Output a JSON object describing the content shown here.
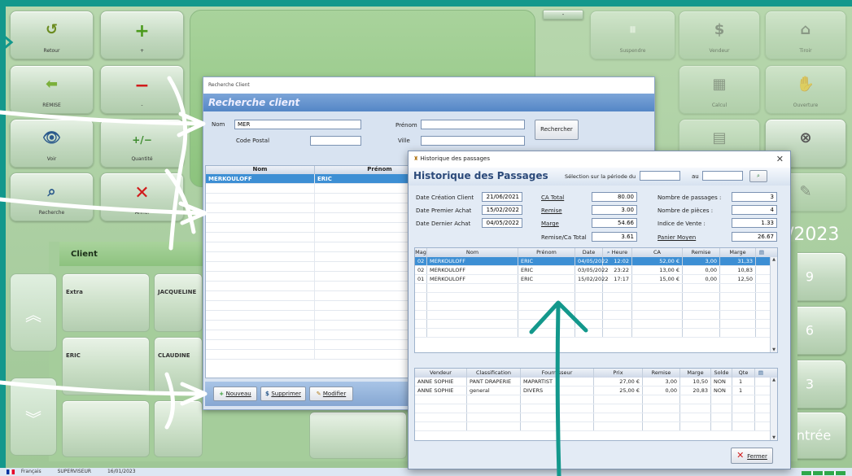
{
  "pos": {
    "tiles_left": [
      {
        "label": "Retour",
        "icon": "↺"
      },
      {
        "label": "+",
        "icon": "+"
      },
      {
        "label": "REMISE",
        "icon": "⬅"
      },
      {
        "label": "-",
        "icon": "−"
      },
      {
        "label": "Voir",
        "icon": "👁"
      },
      {
        "label": "Quantité",
        "icon": "+/−"
      },
      {
        "label": "Recherche",
        "icon": "⌕"
      },
      {
        "label": "Annul",
        "icon": "✕"
      }
    ],
    "tiles_right": [
      {
        "label": "Suspendre",
        "icon": "⏸"
      },
      {
        "label": "Vendeur",
        "icon": "$"
      },
      {
        "label": "Tiroir",
        "icon": "⌂"
      },
      {
        "label": "Calcul",
        "icon": "▦"
      },
      {
        "label": "Ouverture",
        "icon": "✋"
      },
      {
        "label": "",
        "icon": "▤"
      },
      {
        "label": "",
        "icon": "⊗"
      },
      {
        "label": "",
        "icon": "✎"
      }
    ],
    "top_small_btn": "-",
    "date_fragment": "/2023",
    "numpad": [
      "9",
      "6",
      "3"
    ],
    "enter_label": "Entrée",
    "client_section_title": "Client",
    "client_tiles": [
      "Extra",
      "JACQUELINE",
      "ERIC",
      "CLAUDINE"
    ],
    "status": {
      "language": "Français",
      "user": "SUPERVISEUR",
      "date": "16/01/2023"
    }
  },
  "recherche": {
    "window_title": "Recherche Client",
    "header": "Recherche client",
    "labels": {
      "nom": "Nom",
      "code_postal": "Code Postal",
      "prenom": "Prénom",
      "ville": "Ville"
    },
    "values": {
      "nom": "MER",
      "code_postal": "",
      "prenom": "",
      "ville": ""
    },
    "search_button": "Rechercher",
    "columns": [
      "Nom",
      "Prénom"
    ],
    "rows": [
      {
        "nom": "MERKOULOFF",
        "prenom": "ERIC"
      }
    ],
    "buttons": {
      "nouveau": "Nouveau",
      "supprimer": "Supprimer",
      "modifier": "Modifier"
    }
  },
  "historique": {
    "window_title": "Historique des passages",
    "header": "Historique des Passages",
    "period_label": "Sélection sur la période du",
    "period_to": "au",
    "period_from_value": "",
    "period_to_value": "",
    "stats": {
      "date_creation_label": "Date Création Client",
      "date_creation": "21/06/2021",
      "date_premier_label": "Date Premier Achat",
      "date_premier": "15/02/2022",
      "date_dernier_label": "Date Dernier Achat",
      "date_dernier": "04/05/2022",
      "ca_total_label": "CA Total",
      "ca_total": "80.00",
      "remise_label": "Remise",
      "remise": "3.00",
      "marge_label": "Marge",
      "marge": "54.66",
      "remise_ca_label": "Remise/Ca Total",
      "remise_ca": "3.61",
      "nb_passages_label": "Nombre de passages :",
      "nb_passages": "3",
      "nb_pieces_label": "Nombre de pièces :",
      "nb_pieces": "4",
      "indice_label": "Indice de Vente :",
      "indice": "1.33",
      "panier_label": "Panier Moyen",
      "panier": "26.67"
    },
    "passages_columns": [
      "Mag",
      "Nom",
      "Prénom",
      "Date",
      "Heure",
      "CA",
      "Remise",
      "Marge"
    ],
    "passages": [
      {
        "mag": "02",
        "nom": "MERKOULOFF",
        "prenom": "ERIC",
        "date": "04/05/2022",
        "heure": "12:02",
        "ca": "52,00 €",
        "remise": "3,00",
        "marge": "31,33"
      },
      {
        "mag": "02",
        "nom": "MERKOULOFF",
        "prenom": "ERIC",
        "date": "03/05/2022",
        "heure": "23:22",
        "ca": "13,00 €",
        "remise": "0,00",
        "marge": "10,83"
      },
      {
        "mag": "01",
        "nom": "MERKOULOFF",
        "prenom": "ERIC",
        "date": "15/02/2022",
        "heure": "17:17",
        "ca": "15,00 €",
        "remise": "0,00",
        "marge": "12,50"
      }
    ],
    "detail_columns": [
      "Vendeur",
      "Classification",
      "Fournisseur",
      "Prix",
      "Remise",
      "Marge",
      "Solde",
      "Qte"
    ],
    "details": [
      {
        "vendeur": "ANNE SOPHIE",
        "classification": "PANT DRAPERIE",
        "fournisseur": "MAPARTIST",
        "prix": "27,00 €",
        "remise": "3,00",
        "marge": "10,50",
        "solde": "NON",
        "qte": "1"
      },
      {
        "vendeur": "ANNE SOPHIE",
        "classification": "general",
        "fournisseur": "DIVERS",
        "prix": "25,00 €",
        "remise": "0,00",
        "marge": "20,83",
        "solde": "NON",
        "qte": "1"
      }
    ],
    "close_button": "Fermer"
  },
  "colors": {
    "teal": "#13988c",
    "accent_blue": "#3d8fd4",
    "pos_green": "#b7d7ad"
  }
}
